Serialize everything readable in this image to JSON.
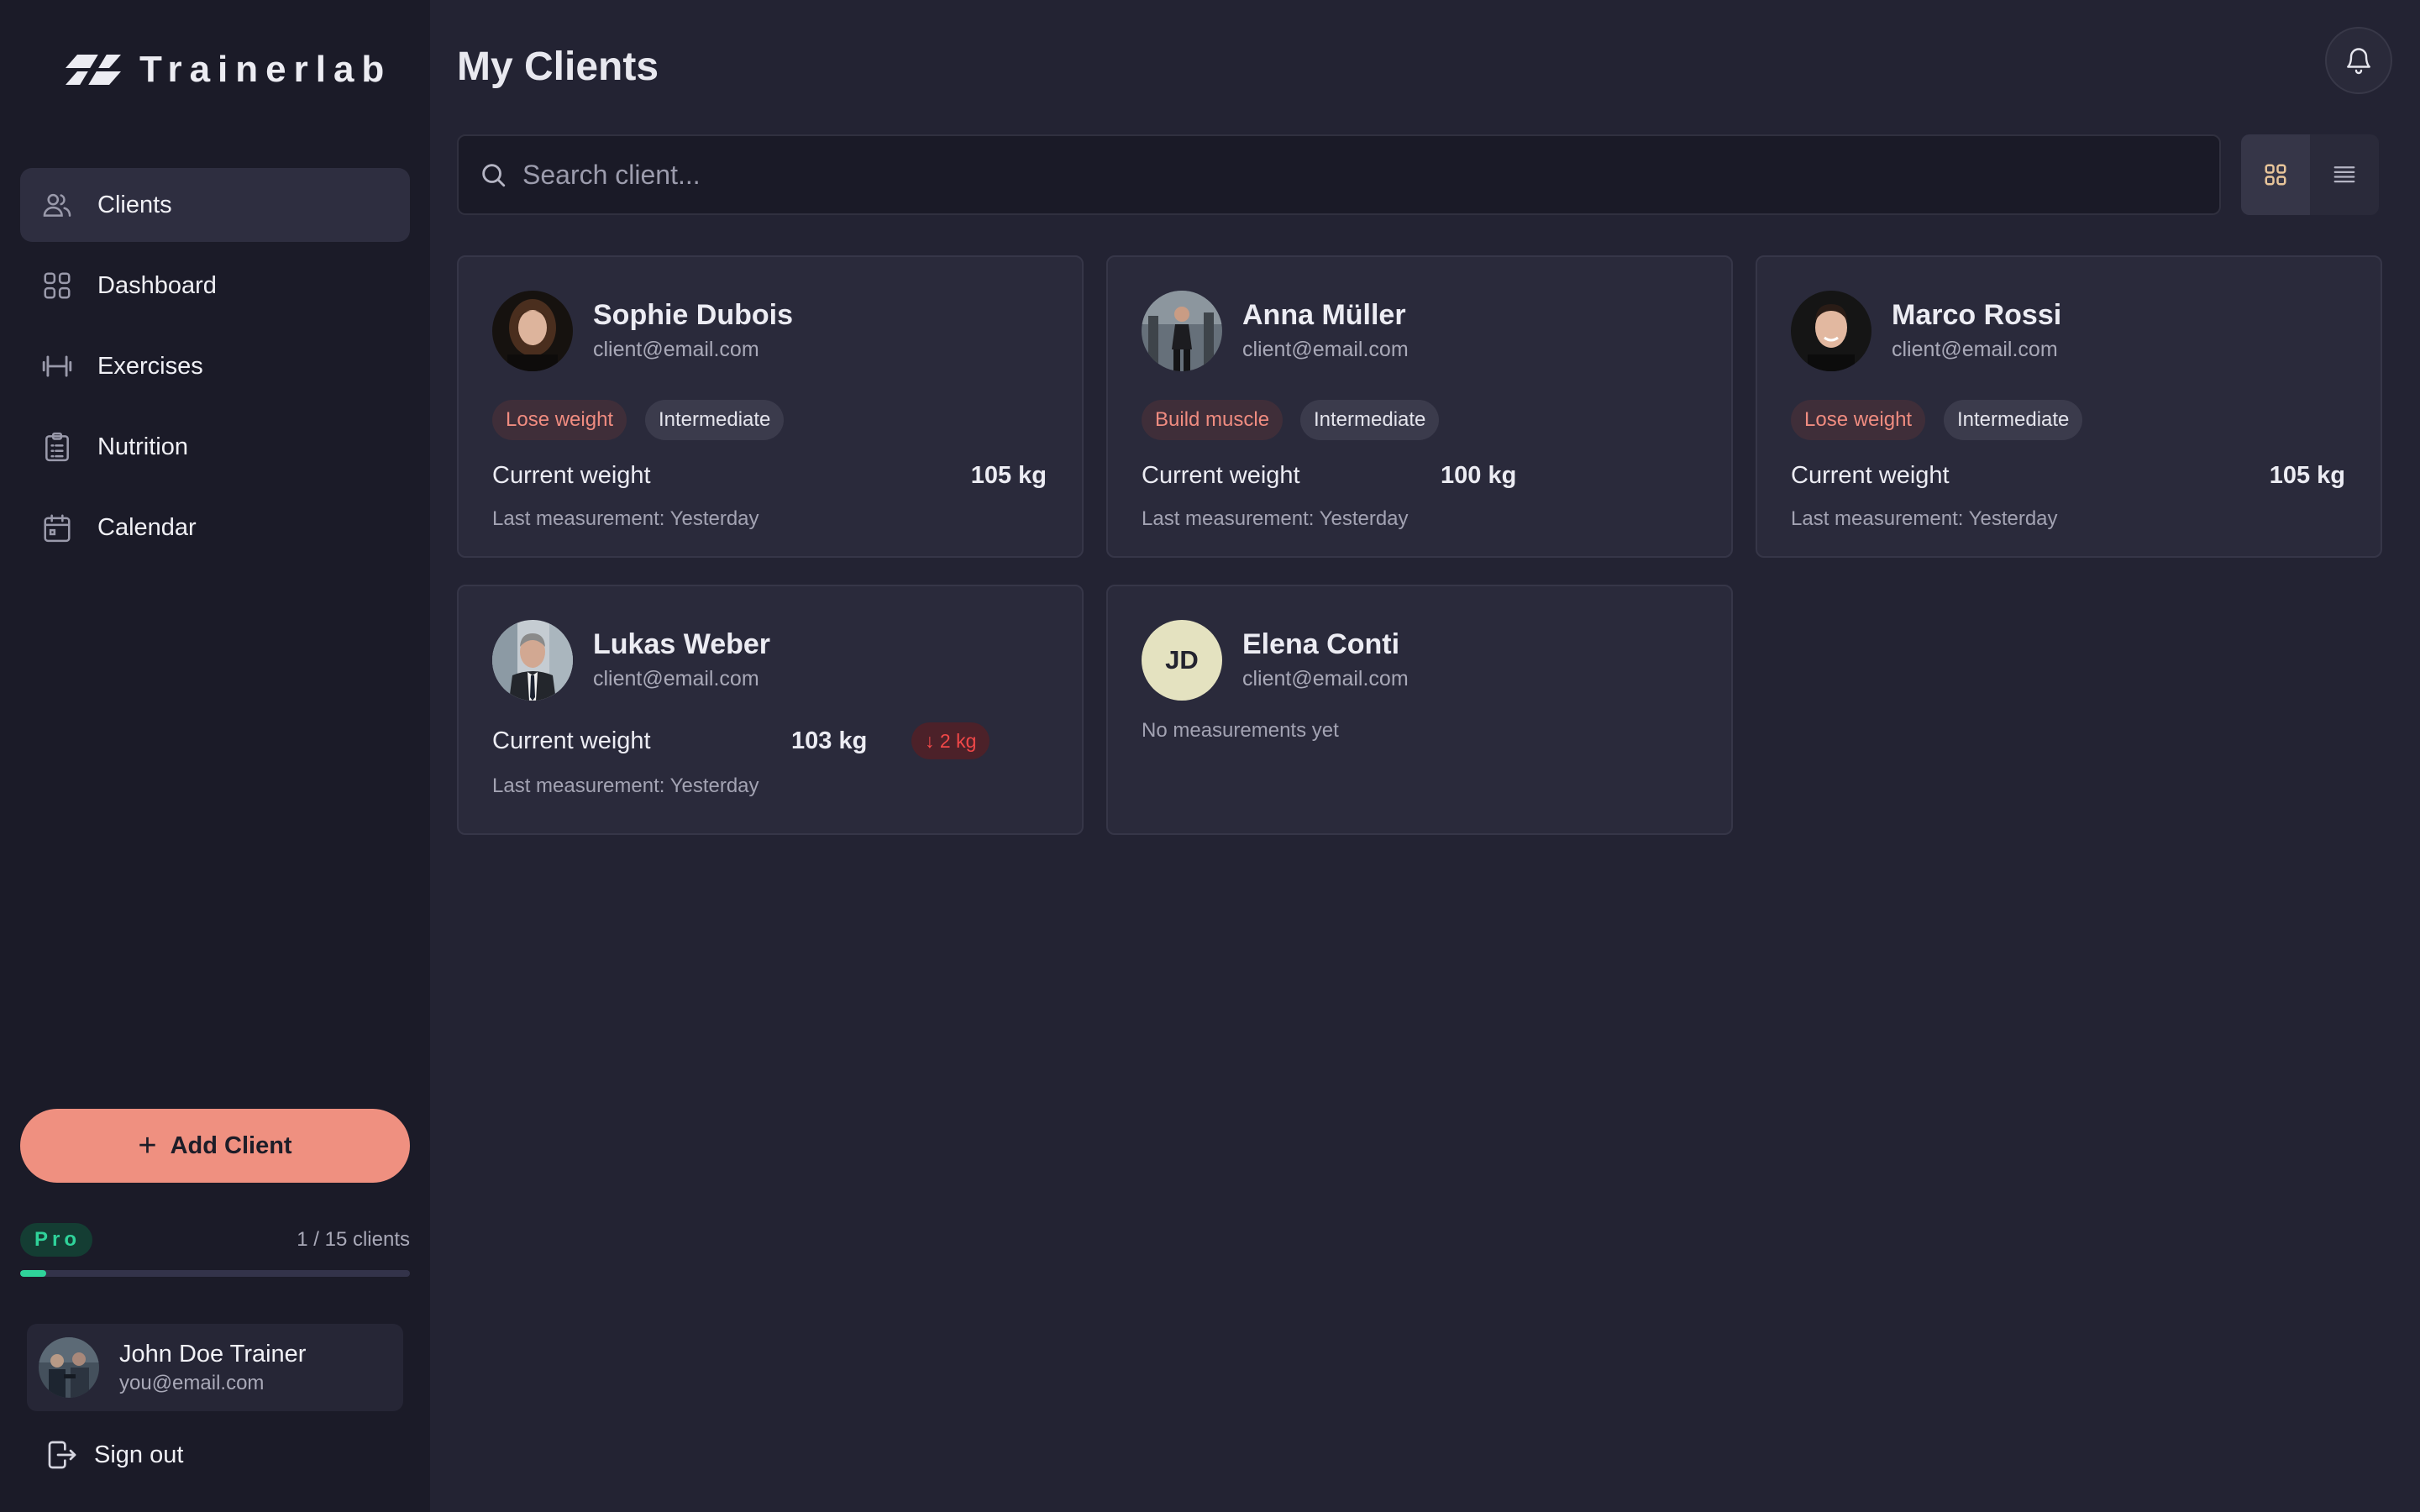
{
  "app": {
    "name": "Trainerlab"
  },
  "sidebar": {
    "items": [
      {
        "label": "Clients",
        "icon": "users-icon",
        "active": true
      },
      {
        "label": "Dashboard",
        "icon": "grid-icon",
        "active": false
      },
      {
        "label": "Exercises",
        "icon": "dumbbell-icon",
        "active": false
      },
      {
        "label": "Nutrition",
        "icon": "clipboard-icon",
        "active": false
      },
      {
        "label": "Calendar",
        "icon": "calendar-icon",
        "active": false
      }
    ],
    "add_client_label": "Add Client",
    "plan": {
      "badge": "Pro",
      "usage": "1 / 15 clients",
      "used": 1,
      "limit": 15
    },
    "user": {
      "name": "John Doe Trainer",
      "email": "you@email.com"
    },
    "signout_label": "Sign out"
  },
  "header": {
    "title": "My Clients"
  },
  "search": {
    "placeholder": "Search client...",
    "value": ""
  },
  "view": {
    "mode": "grid"
  },
  "clients": [
    {
      "name": "Sophie Dubois",
      "email": "client@email.com",
      "goal": "Lose weight",
      "level": "Intermediate",
      "weight_label": "Current weight",
      "weight": "105 kg",
      "last": "Last measurement: Yesterday"
    },
    {
      "name": "Anna Müller",
      "email": "client@email.com",
      "goal": "Build muscle",
      "level": "Intermediate",
      "weight_label": "Current weight",
      "weight": "100 kg",
      "last": "Last measurement: Yesterday"
    },
    {
      "name": "Marco Rossi",
      "email": "client@email.com",
      "goal": "Lose weight",
      "level": "Intermediate",
      "weight_label": "Current weight",
      "weight": "105 kg",
      "last": "Last measurement: Yesterday"
    },
    {
      "name": "Lukas Weber",
      "email": "client@email.com",
      "weight_label": "Current weight",
      "weight": "103 kg",
      "delta": "↓ 2 kg",
      "last": "Last measurement: Yesterday"
    },
    {
      "name": "Elena Conti",
      "email": "client@email.com",
      "initials": "JD",
      "no_data": "No measurements yet"
    }
  ],
  "colors": {
    "accent": "#ef9080",
    "pro": "#2fd39a",
    "background": "#232333",
    "sidebar": "#1b1b28",
    "card": "#2a2a3b"
  }
}
